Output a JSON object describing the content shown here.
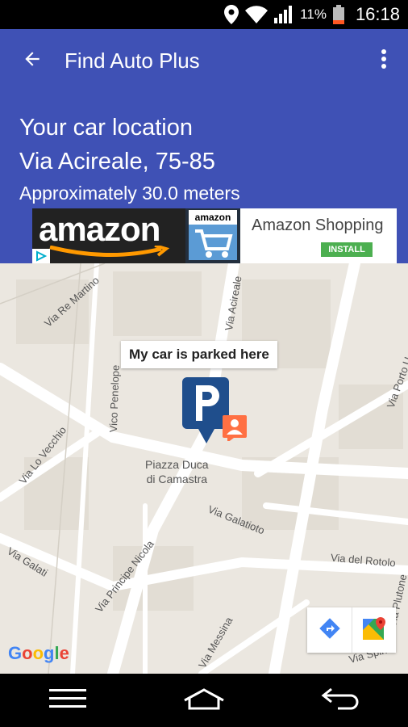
{
  "status_bar": {
    "battery_pct": "11%",
    "time": "16:18",
    "icons": [
      "location-icon",
      "wifi-icon",
      "signal-icon",
      "battery-icon"
    ]
  },
  "app_bar": {
    "title": "Find Auto Plus",
    "back_icon": "arrow-back-icon",
    "menu_icon": "more-vert-icon",
    "color": "#3f51b5"
  },
  "info": {
    "line1": "Your car location",
    "line2": "Via Acireale, 75-85",
    "line3": "Approximately 30.0 meters"
  },
  "ad": {
    "brand": "amazon",
    "app_label": "amazon",
    "title": "Amazon Shopping",
    "install": "INSTALL"
  },
  "map": {
    "marker_label": "My car is parked here",
    "poi": "Piazza Duca\ndi Camastra",
    "streets": [
      "Via Re Martino",
      "Via Acireale",
      "Vico Penelope",
      "Via Lo Vecchio",
      "Via Porto U",
      "Via Galatioto",
      "Via Galati",
      "Via Principe Nicola",
      "Via del Rotolo",
      "Via Plutone",
      "Via Messina",
      "Via Spina"
    ],
    "attribution": "Google",
    "controls": [
      "directions-icon",
      "google-maps-icon"
    ]
  },
  "nav_bar": {
    "icons": [
      "menu-icon",
      "home-icon",
      "back-icon"
    ]
  }
}
